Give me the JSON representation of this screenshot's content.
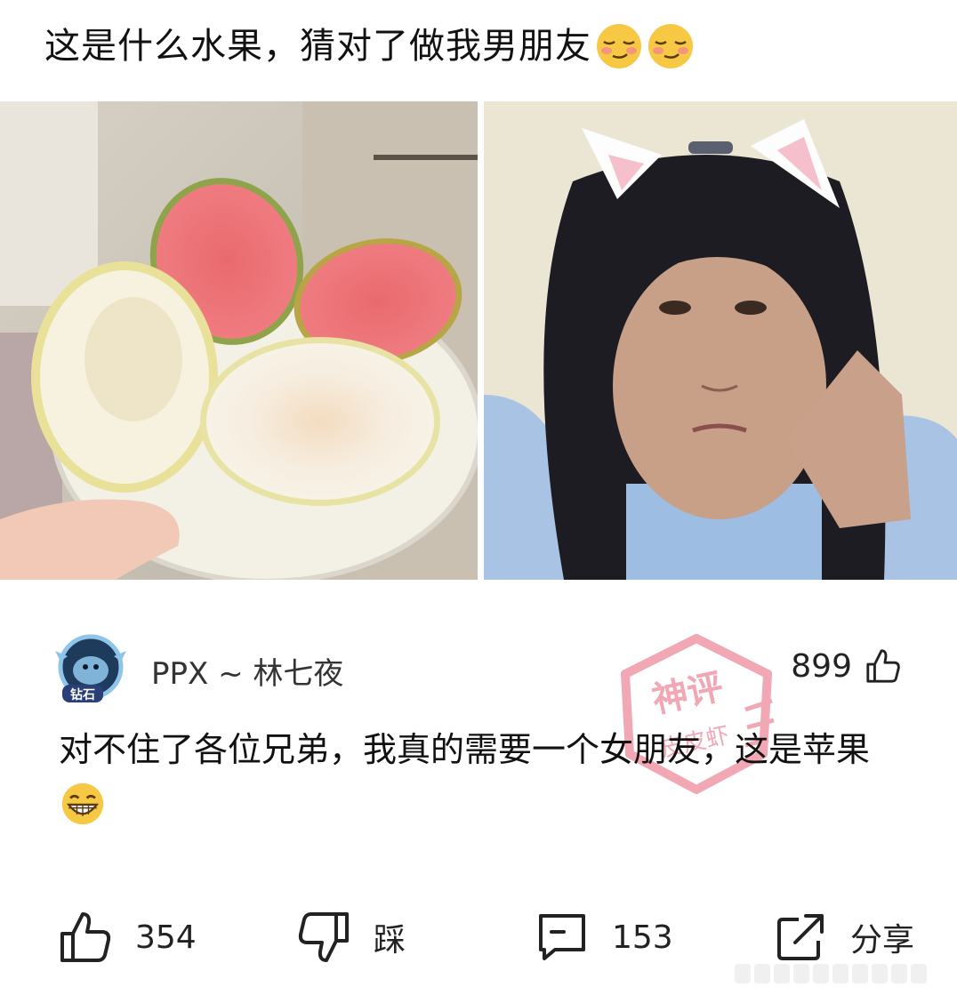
{
  "post": {
    "title": "这是什么水果，猜对了做我男朋友",
    "title_emojis": [
      "smirk-emoji",
      "smirk-emoji"
    ]
  },
  "photos": [
    {
      "name": "guava-plate-photo"
    },
    {
      "name": "cat-ears-selfie-photo"
    }
  ],
  "comment": {
    "username": "PPX ~ 林七夜",
    "badge_label": "钻石",
    "like_count": "899",
    "stamp_text": [
      "神评",
      "皮皮虾"
    ],
    "text": "对不住了各位兄弟，我真的需要一个女朋友，这是苹果",
    "text_emoji": "grin-emoji"
  },
  "actions": {
    "like_count": "354",
    "dislike_label": "踩",
    "comment_count": "153",
    "share_label": "分享"
  },
  "colors": {
    "text": "#111111",
    "secondary": "#333333",
    "stamp": "#e8607a",
    "emoji": "#f7c843"
  }
}
